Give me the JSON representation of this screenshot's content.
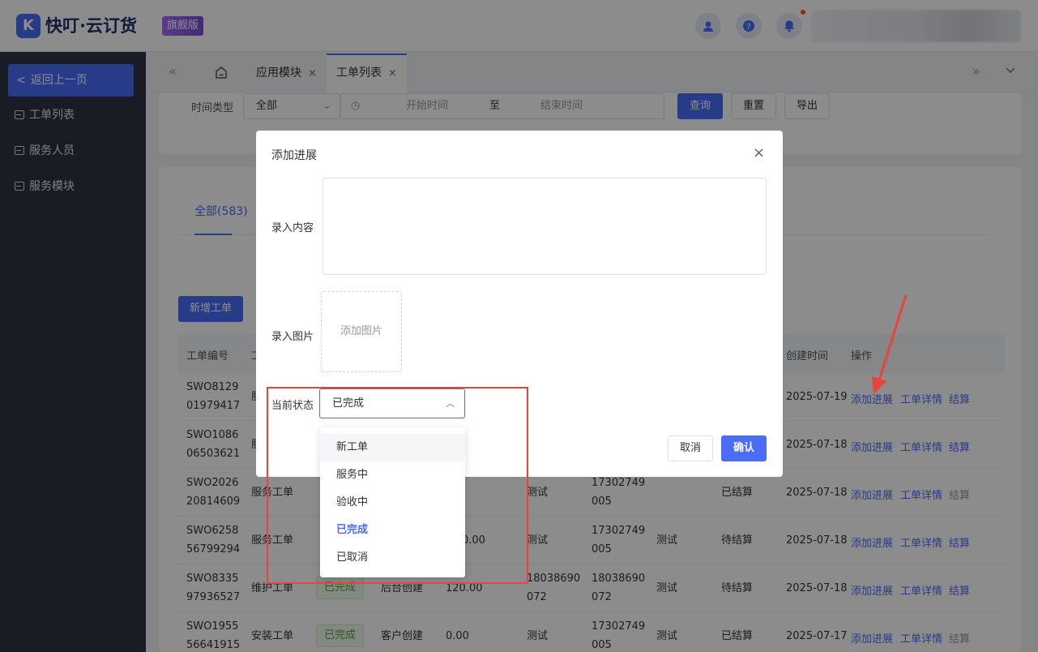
{
  "header": {
    "logo_mark": "K",
    "logo_text": "快叮·云订货",
    "badge": "旗舰版",
    "icons": [
      "support-icon",
      "help-icon",
      "bell-icon"
    ]
  },
  "sidebar": {
    "back_label": "返回上一页",
    "items": [
      {
        "label": "工单列表"
      },
      {
        "label": "服务人员"
      },
      {
        "label": "服务模块"
      }
    ]
  },
  "tabs": [
    {
      "label": "应用模块",
      "close": "×"
    },
    {
      "label": "工单列表",
      "close": "×"
    }
  ],
  "filters": {
    "time_type_label": "时间类型",
    "time_type_value": "全部",
    "start_placeholder": "开始时间",
    "separator": "至",
    "end_placeholder": "结束时间",
    "query": "查询",
    "reset": "重置",
    "export": "导出"
  },
  "list": {
    "all_tab": "全部(583)",
    "add_button": "新增工单",
    "columns": [
      "工单编号",
      "工",
      "创建时间",
      "操作"
    ],
    "rows": [
      {
        "id1": "SWO8129",
        "id2": "01979417",
        "type": "服",
        "time": "2025-07-19",
        "ops": [
          "添加进展",
          "工单详情",
          "结算"
        ],
        "settle_disabled": false
      },
      {
        "id1": "SWO1086",
        "id2": "06503621",
        "type": "服",
        "time": "2025-07-18",
        "ops": [
          "添加进展",
          "工单详情",
          "结算"
        ],
        "settle_disabled": false
      },
      {
        "id1": "SWO2026",
        "id2": "20814609",
        "type": "服务工单",
        "status": "",
        "source": "",
        "amount": "",
        "contact": "测试",
        "phone1": "17302749",
        "phone2": "005",
        "remark": "",
        "settle": "已结算",
        "time": "2025-07-18",
        "ops": [
          "添加进展",
          "工单详情",
          "结算"
        ],
        "settle_disabled": true
      },
      {
        "id1": "SWO6258",
        "id2": "56799294",
        "type": "服务工单",
        "status": "",
        "source": "",
        "amount": "0.00",
        "contact": "测试",
        "phone1": "17302749",
        "phone2": "005",
        "remark": "测试",
        "settle": "待结算",
        "time": "2025-07-18",
        "ops": [
          "添加进展",
          "工单详情",
          "结算"
        ],
        "settle_disabled": false
      },
      {
        "id1": "SWO8335",
        "id2": "97936527",
        "type": "维护工单",
        "status": "已完成",
        "source": "后台创建",
        "amount": "120.00",
        "contact1": "18038690",
        "contact2": "072",
        "phone1": "18038690",
        "phone2": "072",
        "remark": "测试",
        "settle": "待结算",
        "time": "2025-07-18",
        "ops": [
          "添加进展",
          "工单详情",
          "结算"
        ],
        "settle_disabled": false
      },
      {
        "id1": "SWO1955",
        "id2": "56641915",
        "type": "安装工单",
        "status": "已完成",
        "source": "客户创建",
        "amount": "0.00",
        "contact": "测试",
        "phone1": "17302749",
        "phone2": "005",
        "remark": "测试",
        "settle": "已结算",
        "time": "2025-07-17",
        "ops": [
          "添加进展",
          "工单详情",
          "结算"
        ],
        "settle_disabled": true
      }
    ]
  },
  "modal": {
    "title": "添加进展",
    "close": "×",
    "content_label": "录入内容",
    "image_label": "录入图片",
    "image_upload": "添加图片",
    "status_label": "当前状态",
    "status_value": "已完成",
    "cancel": "取消",
    "confirm": "确认"
  },
  "dropdown": {
    "options": [
      "新工单",
      "服务中",
      "验收中",
      "已完成",
      "已取消"
    ],
    "selected": "已完成",
    "hovered": "新工单"
  },
  "colors": {
    "primary": "#4a6cf7",
    "sidebar": "#2f3342",
    "annotation": "#e8443a",
    "success": "#52a33f"
  }
}
